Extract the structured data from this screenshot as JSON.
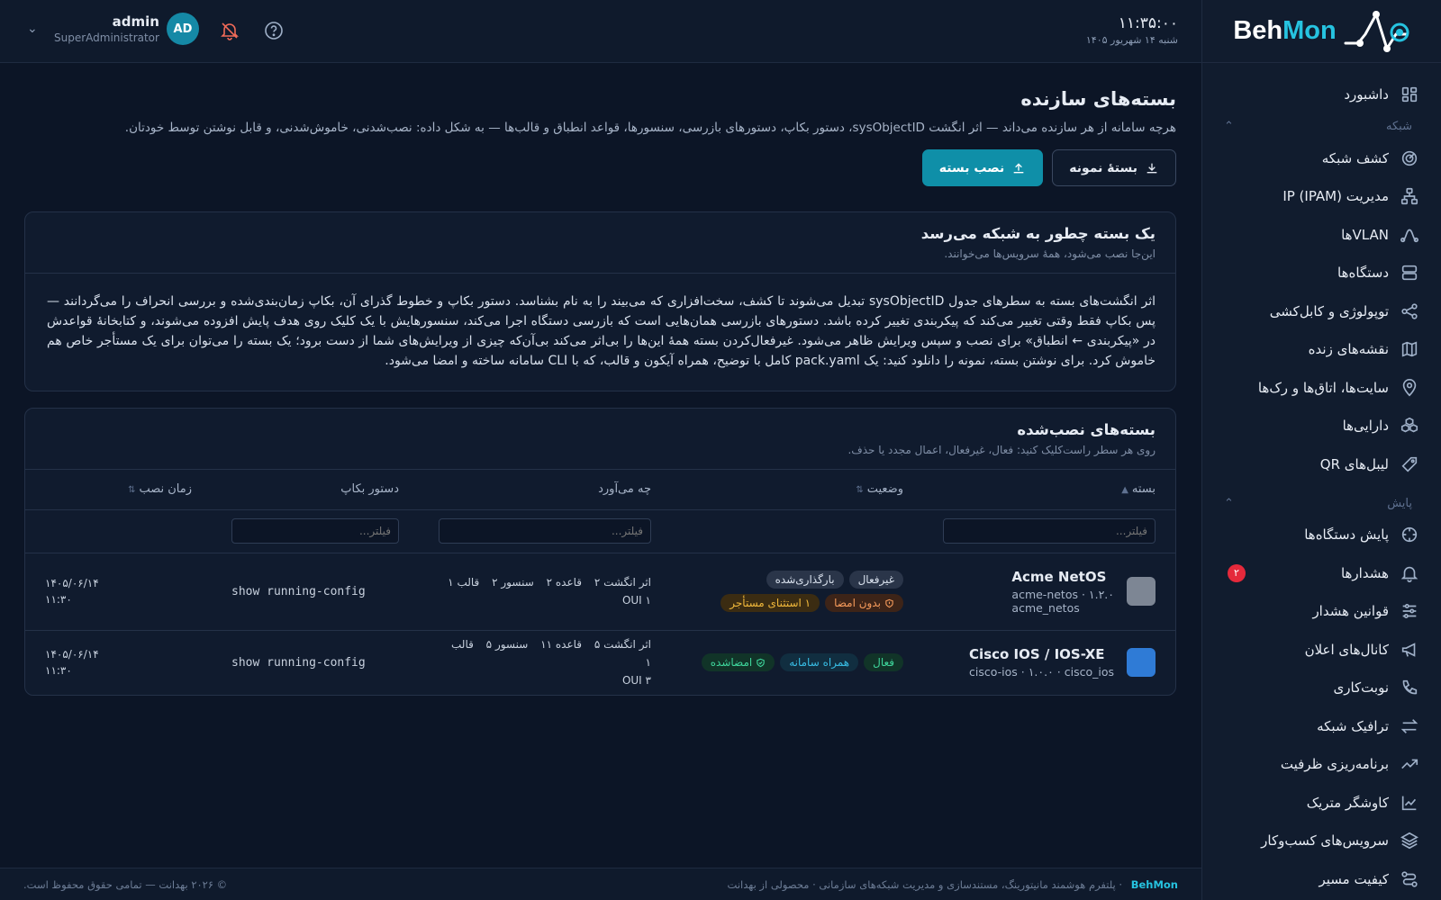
{
  "brand": {
    "part1": "Beh",
    "part2": "Mon"
  },
  "sidebar": {
    "items": [
      {
        "label": "داشبورد",
        "icon": "dashboard-icon"
      },
      {
        "section": "شبکه"
      },
      {
        "label": "کشف شبکه",
        "icon": "radar-icon"
      },
      {
        "label": "مدیریت IP (IPAM)",
        "icon": "network-icon"
      },
      {
        "label": "VLANها",
        "icon": "vlan-icon"
      },
      {
        "label": "دستگاه‌ها",
        "icon": "server-icon"
      },
      {
        "label": "توپولوژی و کابل‌کشی",
        "icon": "share-icon"
      },
      {
        "label": "نقشه‌های زنده",
        "icon": "map-icon"
      },
      {
        "label": "سایت‌ها، اتاق‌ها و رک‌ها",
        "icon": "pin-icon"
      },
      {
        "label": "دارایی‌ها",
        "icon": "boxes-icon"
      },
      {
        "label": "لیبل‌های QR",
        "icon": "qr-icon"
      },
      {
        "section": "پایش"
      },
      {
        "label": "پایش دستگاه‌ها",
        "icon": "monitor-icon"
      },
      {
        "label": "هشدارها",
        "icon": "bell-icon",
        "badge": "۲"
      },
      {
        "label": "قوانین هشدار",
        "icon": "sliders-icon"
      },
      {
        "label": "کانال‌های اعلان",
        "icon": "megaphone-icon"
      },
      {
        "label": "نوبت‌کاری",
        "icon": "phone-icon"
      },
      {
        "label": "ترافیک شبکه",
        "icon": "swap-icon"
      },
      {
        "label": "برنامه‌ریزی ظرفیت",
        "icon": "trend-icon"
      },
      {
        "label": "کاوشگر متریک",
        "icon": "chart-icon"
      },
      {
        "label": "سرویس‌های کسب‌وکار",
        "icon": "layers-icon"
      },
      {
        "label": "کیفیت مسیر",
        "icon": "route-icon"
      }
    ]
  },
  "topbar": {
    "time": "۱۱:۳۵:۰۰",
    "date": "شنبه ۱۴ شهریور ۱۴۰۵",
    "user_name": "admin",
    "user_role": "SuperAdministrator",
    "avatar": "AD"
  },
  "page": {
    "title": "بسته‌های سازنده",
    "description": "هرچه سامانه از هر سازنده می‌داند — اثر انگشت sysObjectID، دستور بکاپ، دستورهای بازرسی، سنسورها، قواعد انطباق و قالب‌ها — به شکل داده: نصب‌شدنی، خاموش‌شدنی، و قابل نوشتن توسط خودتان.",
    "btn_sample": "بستهٔ نمونه",
    "btn_install": "نصب بسته"
  },
  "info_card": {
    "title": "یک بسته چطور به شبکه می‌رسد",
    "subtitle": "این‌جا نصب می‌شود، همهٔ سرویس‌ها می‌خوانند.",
    "body": "اثر انگشت‌های بسته به سطرهای جدول sysObjectID تبدیل می‌شوند تا کشف، سخت‌افزاری که می‌بیند را به نام بشناسد. دستور بکاپ و خطوط گذرای آن، بکاپ زمان‌بندی‌شده و بررسی انحراف را می‌گردانند — پس بکاپ فقط وقتی تغییر می‌کند که پیکربندی تغییر کرده باشد. دستورهای بازرسی همان‌هایی است که بازرسی دستگاه اجرا می‌کند، سنسورهایش با یک کلیک روی هدف پایش افزوده می‌شوند، و کتابخانهٔ قواعدش در «پیکربندی ← انطباق» برای نصب و سپس ویرایش ظاهر می‌شود. غیرفعال‌کردن بسته همهٔ این‌ها را بی‌اثر می‌کند بی‌آن‌که چیزی از ویرایش‌های شما از دست برود؛ یک بسته را می‌توان برای یک مستأجر خاص هم خاموش کرد. برای نوشتن بسته، نمونه را دانلود کنید: یک pack.yaml کامل با توضیح، همراه آیکون و قالب، که با CLI سامانه ساخته و امضا می‌شود."
  },
  "table_card": {
    "title": "بسته‌های نصب‌شده",
    "subtitle": "روی هر سطر راست‌کلیک کنید: فعال، غیرفعال، اعمال مجدد یا حذف.",
    "columns": {
      "package": "بسته",
      "status": "وضعیت",
      "brings": "چه می‌آورد",
      "backup": "دستور بکاپ",
      "installed": "زمان نصب"
    },
    "filter_placeholder": "فیلتر...",
    "rows": [
      {
        "name": "Acme NetOS",
        "meta1": "acme-netos · ۱.۲.۰",
        "meta2": "acme_netos",
        "swatch": "#7d8694",
        "chips": [
          {
            "text": "غیرفعال",
            "style": "grey"
          },
          {
            "text": "بارگذاری‌شده",
            "style": "grey"
          },
          {
            "text": "بدون امضا",
            "style": "orange",
            "icon": "warning-icon"
          },
          {
            "text": "۱ استثنای مستأجر",
            "style": "yellow"
          }
        ],
        "brings_line1": [
          "اثر انگشت ۲",
          "قاعده ۲",
          "سنسور ۲",
          "قالب ۱"
        ],
        "brings_line2": "۱ OUI",
        "backup": "show running-config",
        "date": "۱۴۰۵/۰۶/۱۴",
        "time": "۱۱:۳۰"
      },
      {
        "name": "Cisco IOS / IOS-XE",
        "meta1": "cisco-ios · ۱.۰.۰ · cisco_ios",
        "meta2": "",
        "swatch": "#2f7bd6",
        "chips": [
          {
            "text": "فعال",
            "style": "green"
          },
          {
            "text": "همراه سامانه",
            "style": "blue"
          },
          {
            "text": "امضاشده",
            "style": "green",
            "icon": "shield-icon"
          }
        ],
        "brings_line1": [
          "اثر انگشت ۵",
          "قاعده ۱۱",
          "سنسور ۵",
          "قالب ۱"
        ],
        "brings_line2": "۳ OUI",
        "backup": "show running-config",
        "date": "۱۴۰۵/۰۶/۱۴",
        "time": "۱۱:۳۰"
      }
    ]
  },
  "footer": {
    "brand": "BehMon",
    "tagline": "پلتفرم هوشمند مانیتورینگ، مستندسازی و مدیریت شبکه‌های سازمانی",
    "product_of": "محصولی از بهدانت",
    "copyright": "© ۲۰۲۶ بهدانت — تمامی حقوق محفوظ است."
  }
}
